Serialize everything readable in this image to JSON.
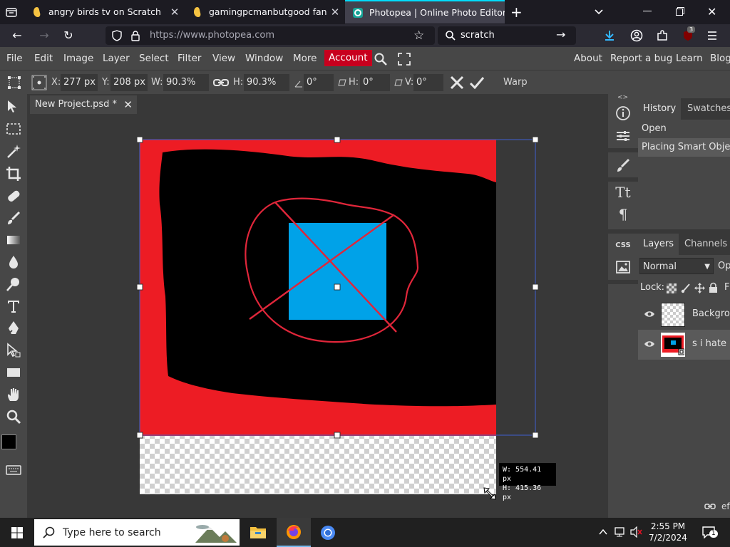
{
  "browser": {
    "tabs": [
      {
        "title": "angry birds tv on Scratch"
      },
      {
        "title": "gamingpcmanbutgood fan plac"
      },
      {
        "title": "Photopea | Online Photo Editor"
      }
    ],
    "new_tab": "+",
    "url": "https://www.photopea.com",
    "search": "scratch",
    "extension_badge": "3"
  },
  "menu": {
    "items": [
      "File",
      "Edit",
      "Image",
      "Layer",
      "Select",
      "Filter",
      "View",
      "Window",
      "More"
    ],
    "account": "Account",
    "right_items": [
      "About",
      "Report a bug",
      "Learn",
      "Blog"
    ]
  },
  "options": {
    "x_label": "X:",
    "x_value": "277 px",
    "y_label": "Y:",
    "y_value": "208 px",
    "w_label": "W:",
    "w_value": "90.3%",
    "h_label": "H:",
    "h_value": "90.3%",
    "angle_value": "0°",
    "skew_h_label": "H:",
    "skew_h_value": "0°",
    "skew_v_label": "V:",
    "skew_v_value": "0°",
    "warp_label": "Warp"
  },
  "document": {
    "tab_title": "New Project.psd *",
    "dimensions_tooltip": {
      "w": "W: 554.41 px",
      "h": "H: 415.36 px"
    }
  },
  "history_panel": {
    "tabs": [
      "History",
      "Swatches"
    ],
    "entries": [
      "Open",
      "Placing Smart Object"
    ]
  },
  "layers_panel": {
    "tabs": [
      "Layers",
      "Channels"
    ],
    "blend_mode": "Normal",
    "opacity_label": "Op",
    "lock_label": "Lock:",
    "fill_label": "F",
    "layers": [
      {
        "name": "Background"
      },
      {
        "name": "s i hate b"
      }
    ],
    "footer_label": "ef"
  },
  "colors": {
    "accent_red": "#c8001e",
    "canvas_red": "#ed1c24",
    "canvas_blue": "#00a2e8",
    "active_tab_highlight": "#00ddff"
  },
  "taskbar": {
    "search_placeholder": "Type here to search",
    "time": "2:55 PM",
    "date": "7/2/2024",
    "notification_count": "1"
  }
}
